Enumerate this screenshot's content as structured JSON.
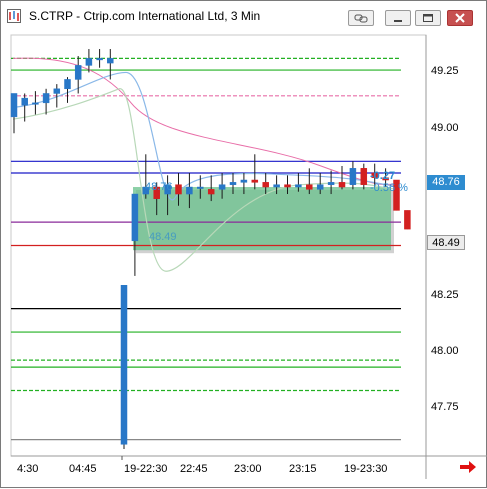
{
  "window": {
    "title": "S.CTRP - Ctrip.com International Ltd, 3 Min"
  },
  "icons": {
    "app": "chart-app-icon",
    "link": "link-icon",
    "minimize": "minimize-icon",
    "maximize": "maximize-icon",
    "close": "close-icon",
    "scroll_right": "red-arrow-right-icon"
  },
  "colors": {
    "up_candle": "#2877c7",
    "down_candle": "#d32020",
    "price_tag_current": "#2e8cd0",
    "measure_box": "#66c08a"
  },
  "axis": {
    "y_ticks": [
      "49.25",
      "49.00",
      "48.75",
      "48.50",
      "48.25",
      "48.00",
      "47.75"
    ],
    "x_ticks": [
      "4:30",
      "04:45",
      "19-22:30",
      "22:45",
      "23:00",
      "23:15",
      "19-23:30"
    ],
    "current_price": "48.76",
    "crosshair_price": "48.49"
  },
  "measure_tool": {
    "start_price": "48.76",
    "end_price": "48.49",
    "change": "-0.27",
    "change_pct": "-0.56 %"
  },
  "chart_data": {
    "type": "candlestick",
    "ylim": [
      47.61,
      49.41
    ],
    "x_ticks": [
      "4:30",
      "04:45",
      "19-22:30",
      "22:45",
      "23:00",
      "23:15",
      "19-23:30"
    ],
    "candles": [
      {
        "o": 49.06,
        "h": 49.16,
        "l": 48.99,
        "c": 49.16
      },
      {
        "o": 49.11,
        "h": 49.16,
        "l": 49.04,
        "c": 49.14
      },
      {
        "o": 49.12,
        "h": 49.17,
        "l": 49.07,
        "c": 49.12
      },
      {
        "o": 49.12,
        "h": 49.18,
        "l": 49.07,
        "c": 49.16
      },
      {
        "o": 49.16,
        "h": 49.2,
        "l": 49.1,
        "c": 49.18
      },
      {
        "o": 49.18,
        "h": 49.23,
        "l": 49.12,
        "c": 49.22
      },
      {
        "o": 49.22,
        "h": 49.32,
        "l": 49.16,
        "c": 49.28
      },
      {
        "o": 49.28,
        "h": 49.35,
        "l": 49.25,
        "c": 49.31
      },
      {
        "o": 49.31,
        "h": 49.35,
        "l": 49.27,
        "c": 49.31
      },
      {
        "o": 49.29,
        "h": 49.35,
        "l": 49.22,
        "c": 49.31
      },
      {
        "o": 47.66,
        "h": 48.34,
        "l": 47.64,
        "c": 48.34
      },
      {
        "o": 48.53,
        "h": 48.73,
        "l": 48.38,
        "c": 48.73
      },
      {
        "o": 48.73,
        "h": 48.9,
        "l": 48.71,
        "c": 48.76
      },
      {
        "o": 48.76,
        "h": 48.78,
        "l": 48.64,
        "c": 48.71
      },
      {
        "o": 48.73,
        "h": 48.81,
        "l": 48.64,
        "c": 48.77
      },
      {
        "o": 48.77,
        "h": 48.82,
        "l": 48.68,
        "c": 48.73
      },
      {
        "o": 48.73,
        "h": 48.82,
        "l": 48.67,
        "c": 48.76
      },
      {
        "o": 48.76,
        "h": 48.81,
        "l": 48.71,
        "c": 48.76
      },
      {
        "o": 48.75,
        "h": 48.81,
        "l": 48.7,
        "c": 48.73
      },
      {
        "o": 48.75,
        "h": 48.82,
        "l": 48.71,
        "c": 48.77
      },
      {
        "o": 48.77,
        "h": 48.82,
        "l": 48.73,
        "c": 48.78
      },
      {
        "o": 48.78,
        "h": 48.82,
        "l": 48.73,
        "c": 48.79
      },
      {
        "o": 48.79,
        "h": 48.9,
        "l": 48.75,
        "c": 48.78
      },
      {
        "o": 48.78,
        "h": 48.82,
        "l": 48.73,
        "c": 48.76
      },
      {
        "o": 48.76,
        "h": 48.81,
        "l": 48.73,
        "c": 48.77
      },
      {
        "o": 48.77,
        "h": 48.81,
        "l": 48.73,
        "c": 48.76
      },
      {
        "o": 48.76,
        "h": 48.82,
        "l": 48.74,
        "c": 48.77
      },
      {
        "o": 48.77,
        "h": 48.84,
        "l": 48.73,
        "c": 48.75
      },
      {
        "o": 48.75,
        "h": 48.82,
        "l": 48.73,
        "c": 48.77
      },
      {
        "o": 48.77,
        "h": 48.83,
        "l": 48.73,
        "c": 48.78
      },
      {
        "o": 48.78,
        "h": 48.85,
        "l": 48.75,
        "c": 48.76
      },
      {
        "o": 48.77,
        "h": 48.87,
        "l": 48.75,
        "c": 48.84
      },
      {
        "o": 48.84,
        "h": 48.86,
        "l": 48.75,
        "c": 48.77
      },
      {
        "o": 48.82,
        "h": 48.86,
        "l": 48.76,
        "c": 48.8
      },
      {
        "o": 48.8,
        "h": 48.84,
        "l": 48.76,
        "c": 48.79
      },
      {
        "o": 48.79,
        "h": 48.79,
        "l": 48.66,
        "c": 48.66
      },
      {
        "o": 48.66,
        "h": 48.66,
        "l": 48.58,
        "c": 48.58
      }
    ],
    "candle_gap_after_index": 9,
    "horizontal_levels": [
      {
        "value": 49.31,
        "color": "#22b022",
        "style": "dashed"
      },
      {
        "value": 49.26,
        "color": "#22b022",
        "style": "solid"
      },
      {
        "value": 49.15,
        "color": "#e86ea8",
        "style": "dashed"
      },
      {
        "value": 48.87,
        "color": "#1a1ac8",
        "style": "solid"
      },
      {
        "value": 48.82,
        "color": "#1a1ac8",
        "style": "solid"
      },
      {
        "value": 48.61,
        "color": "#8a2a9a",
        "style": "solid"
      },
      {
        "value": 48.51,
        "color": "#d32020",
        "style": "solid"
      },
      {
        "value": 48.24,
        "color": "#000000",
        "style": "solid"
      },
      {
        "value": 48.14,
        "color": "#22b022",
        "style": "solid"
      },
      {
        "value": 48.02,
        "color": "#22b022",
        "style": "dashed"
      },
      {
        "value": 47.99,
        "color": "#22b022",
        "style": "solid"
      },
      {
        "value": 47.89,
        "color": "#22b022",
        "style": "dashed"
      },
      {
        "value": 47.68,
        "color": "#888888",
        "style": "solid"
      }
    ]
  }
}
